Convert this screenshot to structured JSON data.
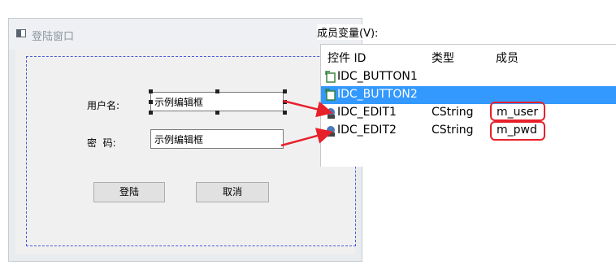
{
  "dialog": {
    "title": "登陆窗口",
    "fields": [
      {
        "label": "用户名:",
        "value": "示例编辑框"
      },
      {
        "label": "密  码:",
        "value": "示例编辑框"
      }
    ],
    "buttons": {
      "login": "登陆",
      "cancel": "取消"
    }
  },
  "member_panel": {
    "title": "成员变量(V):",
    "columns": [
      "控件 ID",
      "类型",
      "成员"
    ],
    "rows": [
      {
        "id": "IDC_BUTTON1",
        "type": "",
        "member": "",
        "icon": "button-icon",
        "selected": false
      },
      {
        "id": "IDC_BUTTON2",
        "type": "",
        "member": "",
        "icon": "button-icon",
        "selected": true
      },
      {
        "id": "IDC_EDIT1",
        "type": "CString",
        "member": "m_user",
        "icon": "edit-control-icon",
        "selected": false
      },
      {
        "id": "IDC_EDIT2",
        "type": "CString",
        "member": "m_pwd",
        "icon": "edit-control-icon",
        "selected": false
      }
    ]
  },
  "colors": {
    "selection": "#3399ff",
    "annotation": "#e8202a",
    "guide": "#4b5bd6"
  }
}
